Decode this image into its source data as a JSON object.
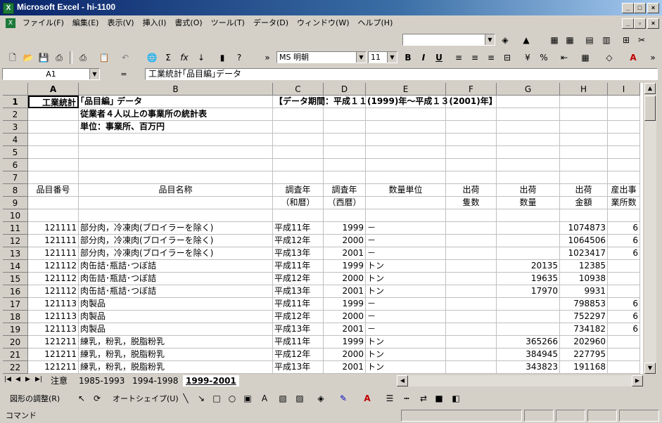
{
  "window": {
    "title": "Microsoft Excel - hi-1100"
  },
  "menu": [
    "ファイル(F)",
    "編集(E)",
    "表示(V)",
    "挿入(I)",
    "書式(O)",
    "ツール(T)",
    "データ(D)",
    "ウィンドウ(W)",
    "ヘルプ(H)"
  ],
  "format_toolbar": {
    "font_name": "MS 明朝",
    "font_size": "11",
    "bold": "B",
    "italic": "I",
    "underline": "U"
  },
  "formula_bar": {
    "name_box": "A1",
    "fx": "=",
    "content": "工業統計｢品目編｣データ"
  },
  "columns": [
    "A",
    "B",
    "C",
    "D",
    "E",
    "F",
    "G",
    "H",
    "I"
  ],
  "rows": [
    {
      "n": "1",
      "cells": [
        "工業統計",
        "｢品目編｣ データ",
        "【データ期間：平成１１(1999)年～平成１３(2001)年】",
        "",
        "",
        "",
        "",
        "",
        ""
      ]
    },
    {
      "n": "2",
      "cells": [
        "",
        "従業者４人以上の事業所の統計表",
        "",
        "",
        "",
        "",
        "",
        "",
        ""
      ]
    },
    {
      "n": "3",
      "cells": [
        "",
        "単位：事業所、百万円",
        "",
        "",
        "",
        "",
        "",
        "",
        ""
      ]
    },
    {
      "n": "4",
      "cells": [
        "",
        "",
        "",
        "",
        "",
        "",
        "",
        "",
        ""
      ]
    },
    {
      "n": "5",
      "cells": [
        "",
        "",
        "",
        "",
        "",
        "",
        "",
        "",
        ""
      ]
    },
    {
      "n": "6",
      "cells": [
        "",
        "",
        "",
        "",
        "",
        "",
        "",
        "",
        ""
      ]
    },
    {
      "n": "7",
      "cells": [
        "",
        "",
        "",
        "",
        "",
        "",
        "",
        "",
        ""
      ]
    },
    {
      "n": "8",
      "cells": [
        "品目番号",
        "品目名称",
        "調査年",
        "調査年",
        "数量単位",
        "出荷",
        "出荷",
        "出荷",
        "産出事"
      ]
    },
    {
      "n": "9",
      "cells": [
        "",
        "",
        "（和暦）",
        "（西暦）",
        "",
        "隻数",
        "数量",
        "金額",
        "業所数"
      ]
    },
    {
      "n": "10",
      "cells": [
        "",
        "",
        "",
        "",
        "",
        "",
        "",
        "",
        ""
      ]
    },
    {
      "n": "11",
      "cells": [
        "121111",
        "部分肉，冷凍肉(ブロイラーを除く)",
        "平成11年",
        "1999",
        "－",
        "",
        "",
        "1074873",
        "6"
      ]
    },
    {
      "n": "12",
      "cells": [
        "121111",
        "部分肉，冷凍肉(ブロイラーを除く)",
        "平成12年",
        "2000",
        "－",
        "",
        "",
        "1064506",
        "6"
      ]
    },
    {
      "n": "13",
      "cells": [
        "121111",
        "部分肉，冷凍肉(ブロイラーを除く)",
        "平成13年",
        "2001",
        "－",
        "",
        "",
        "1023417",
        "6"
      ]
    },
    {
      "n": "14",
      "cells": [
        "121112",
        "肉缶詰･瓶詰･つぼ詰",
        "平成11年",
        "1999",
        "トン",
        "",
        "20135",
        "12385",
        ""
      ]
    },
    {
      "n": "15",
      "cells": [
        "121112",
        "肉缶詰･瓶詰･つぼ詰",
        "平成12年",
        "2000",
        "トン",
        "",
        "19635",
        "10938",
        ""
      ]
    },
    {
      "n": "16",
      "cells": [
        "121112",
        "肉缶詰･瓶詰･つぼ詰",
        "平成13年",
        "2001",
        "トン",
        "",
        "17970",
        "9931",
        ""
      ]
    },
    {
      "n": "17",
      "cells": [
        "121113",
        "肉製品",
        "平成11年",
        "1999",
        "－",
        "",
        "",
        "798853",
        "6"
      ]
    },
    {
      "n": "18",
      "cells": [
        "121113",
        "肉製品",
        "平成12年",
        "2000",
        "－",
        "",
        "",
        "752297",
        "6"
      ]
    },
    {
      "n": "19",
      "cells": [
        "121113",
        "肉製品",
        "平成13年",
        "2001",
        "－",
        "",
        "",
        "734182",
        "6"
      ]
    },
    {
      "n": "20",
      "cells": [
        "121211",
        "練乳，粉乳，脱脂粉乳",
        "平成11年",
        "1999",
        "トン",
        "",
        "365266",
        "202960",
        ""
      ]
    },
    {
      "n": "21",
      "cells": [
        "121211",
        "練乳，粉乳，脱脂粉乳",
        "平成12年",
        "2000",
        "トン",
        "",
        "384945",
        "227795",
        ""
      ]
    },
    {
      "n": "22",
      "cells": [
        "121211",
        "練乳，粉乳，脱脂粉乳",
        "平成13年",
        "2001",
        "トン",
        "",
        "343823",
        "191168",
        ""
      ]
    }
  ],
  "sheet_tabs": [
    "注意",
    "1985-1993",
    "1994-1998",
    "1999-2001"
  ],
  "active_tab": "1999-2001",
  "draw_toolbar": {
    "draw_menu": "図形の調整(R)",
    "autoshape": "オートシェイプ(U)"
  },
  "status": {
    "text": "コマンド"
  }
}
